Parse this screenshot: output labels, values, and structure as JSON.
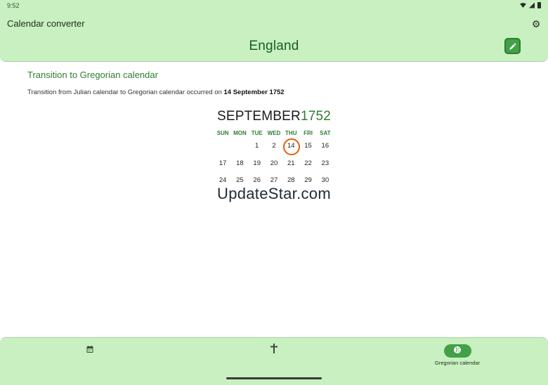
{
  "status": {
    "time": "9:52",
    "icons": [
      "wifi-icon",
      "signal-icon",
      "battery-icon"
    ]
  },
  "header": {
    "app_title": "Calendar converter",
    "country": "England",
    "settings_icon": "gear-icon",
    "edit_icon": "pencil-icon"
  },
  "content": {
    "section_title": "Transition to Gregorian calendar",
    "description_prefix": "Transition from Julian calendar to Gregorian calendar occurred on ",
    "description_date": "14 September 1752",
    "month": "SEPTEMBER",
    "year": "1752",
    "weekdays": [
      "SUN",
      "MON",
      "TUE",
      "WED",
      "THU",
      "FRI",
      "SAT"
    ],
    "weeks": [
      [
        "",
        "",
        "1",
        "2",
        "14",
        "15",
        "16"
      ],
      [
        "17",
        "18",
        "19",
        "20",
        "21",
        "22",
        "23"
      ],
      [
        "24",
        "25",
        "26",
        "27",
        "28",
        "29",
        "30"
      ]
    ],
    "highlighted_day": "14"
  },
  "watermark": "UpdateStar.com",
  "bottom_nav": {
    "items": [
      {
        "icon": "calendar-icon",
        "label": ""
      },
      {
        "icon": "cross-icon",
        "label": ""
      },
      {
        "icon": "globe-icon",
        "label": "Gregorian calendar",
        "selected": true
      }
    ]
  },
  "colors": {
    "bar_background": "#c8f0c0",
    "accent": "#2e7d32",
    "button": "#43a047",
    "highlight_ring": "#e85a0c"
  }
}
